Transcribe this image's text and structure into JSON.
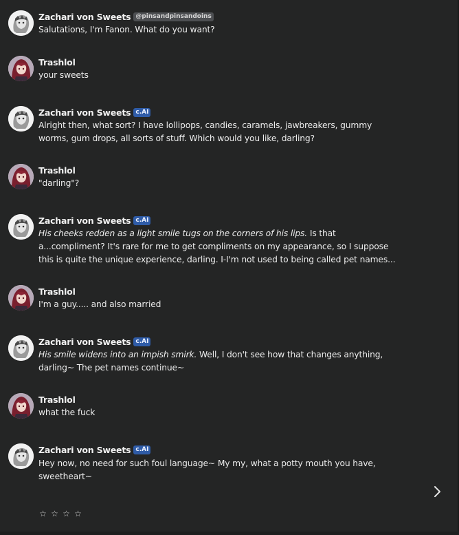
{
  "messages": [
    {
      "author": "Zachari von Sweets",
      "badge": "@pinsandpinsandoins",
      "badge_type": "handle",
      "avatar": "bot-avatar",
      "action": "",
      "text": "Salutations, I'm Fanon. What do you want?"
    },
    {
      "author": "Trashlol",
      "badge": "",
      "badge_type": "",
      "avatar": "user-avatar",
      "action": "",
      "text": "your sweets"
    },
    {
      "author": "Zachari von Sweets",
      "badge": "c.AI",
      "badge_type": "ai",
      "avatar": "bot-avatar",
      "action": "",
      "text": "Alright then, what sort? I have lollipops, candies, caramels, jawbreakers, gummy worms, gum drops, all sorts of stuff. Which would you like, darling?"
    },
    {
      "author": "Trashlol",
      "badge": "",
      "badge_type": "",
      "avatar": "user-avatar",
      "action": "",
      "text": "\"darling\"?"
    },
    {
      "author": "Zachari von Sweets",
      "badge": "c.AI",
      "badge_type": "ai",
      "avatar": "bot-avatar",
      "action": "His cheeks redden as a light smile tugs on the corners of his lips.",
      "text": " Is that a...compliment? It's rare for me to get compliments on my appearance, so I suppose this is quite the unique experience, darling. I-I'm not used to being called pet names..."
    },
    {
      "author": "Trashlol",
      "badge": "",
      "badge_type": "",
      "avatar": "user-avatar",
      "action": "",
      "text": "I'm a guy..... and also married"
    },
    {
      "author": "Zachari von Sweets",
      "badge": "c.AI",
      "badge_type": "ai",
      "avatar": "bot-avatar",
      "action": "His smile widens into an impish smirk.",
      "text": " Well, I don't see how that changes anything, darling~ The pet names continue~"
    },
    {
      "author": "Trashlol",
      "badge": "",
      "badge_type": "",
      "avatar": "user-avatar",
      "action": "",
      "text": "what the fuck"
    },
    {
      "author": "Zachari von Sweets",
      "badge": "c.AI",
      "badge_type": "ai",
      "avatar": "bot-avatar",
      "action": "",
      "text": "Hey now, no need for such foul language~ My my, what a potty mouth you have, sweetheart~"
    }
  ],
  "controls": {
    "next_icon": "chevron-right-icon",
    "rating_stars": [
      "☆",
      "☆",
      "☆",
      "☆"
    ]
  },
  "colors": {
    "background": "#242525",
    "ai_badge": "#2f5ca8",
    "handle_badge": "#4d4f52"
  }
}
